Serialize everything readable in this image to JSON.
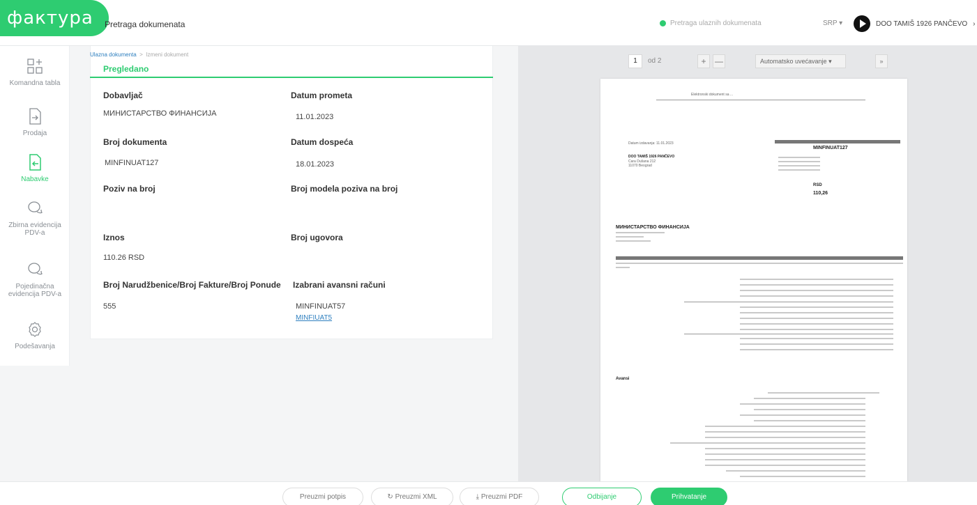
{
  "app": {
    "logo_text": "фактура",
    "page_title": "Pretraga dokumenata",
    "search_status": "Pretraga ulaznih dokumenata",
    "language": "SRP",
    "company": "DOO TAMIŠ 1926 PANČEVO",
    "brand_color": "#2ecc71"
  },
  "sidebar": {
    "items": [
      {
        "label": "Komandna tabla",
        "icon": "dashboard-icon"
      },
      {
        "label": "Prodaja",
        "icon": "outgoing-document-icon"
      },
      {
        "label": "Nabavke",
        "icon": "incoming-document-icon",
        "active": true
      },
      {
        "label": "Zbirna evidencija PDV-a",
        "icon": "chat-bubbles-icon"
      },
      {
        "label": "Pojedinačna evidencija PDV-a",
        "icon": "chat-bubbles-icon"
      },
      {
        "label": "Podešavanja",
        "icon": "gear-icon"
      }
    ]
  },
  "breadcrumb": {
    "parent": "Ulazna dokumenta",
    "separator": ">",
    "current": "Izmeni dokument"
  },
  "status": "Pregledano",
  "fields": {
    "supplier_label": "Dobavljač",
    "supplier_value": "МИНИСТАРСТВО ФИНАНСИЈА",
    "turnover_date_label": "Datum prometa",
    "turnover_date_value": "11.01.2023",
    "doc_number_label": "Broj dokumenta",
    "doc_number_value": "MINFINUAT127",
    "due_date_label": "Datum dospeća",
    "due_date_value": "18.01.2023",
    "reference_label": "Poziv na broj",
    "reference_model_label": "Broj modela poziva na broj",
    "amount_label": "Iznos",
    "amount_value": "110.26 RSD",
    "contract_label": "Broj ugovora",
    "order_label": "Broj Narudžbenice/Broj Fakture/Broj Ponude",
    "order_value": "555",
    "advance_label": "Izabrani avansni računi",
    "advance_value": "MINFINUAT57",
    "advance_link": "MINFIUAT5"
  },
  "preview": {
    "page": "1",
    "of": "od 2",
    "zoom_in": "+",
    "zoom_out": "—",
    "zoom_select": "Automatsko uvećavanje",
    "sidebar_toggle": "»",
    "invoice_number": "MINFINUAT127",
    "currency": "RSD",
    "total": "110,26",
    "buyer_name": "DOO TAMIŠ 1926 PANČEVO",
    "seller_name": "МИНИСТАРСТВО ФИНАНСИЈА",
    "section_advances": "Avansi",
    "header_line": "Elektronski dokument sa ...",
    "doc_date": "Datum izdavanja: 11.01.2023",
    "address_1": "Cara Dušana 212",
    "address_2": "11070 Beograd"
  },
  "actions": {
    "download_signature": "Preuzmi potpis",
    "download_xml": "Preuzmi XML",
    "download_pdf": "Preuzmi PDF",
    "reject": "Odbijanje",
    "approve": "Prihvatanje"
  }
}
